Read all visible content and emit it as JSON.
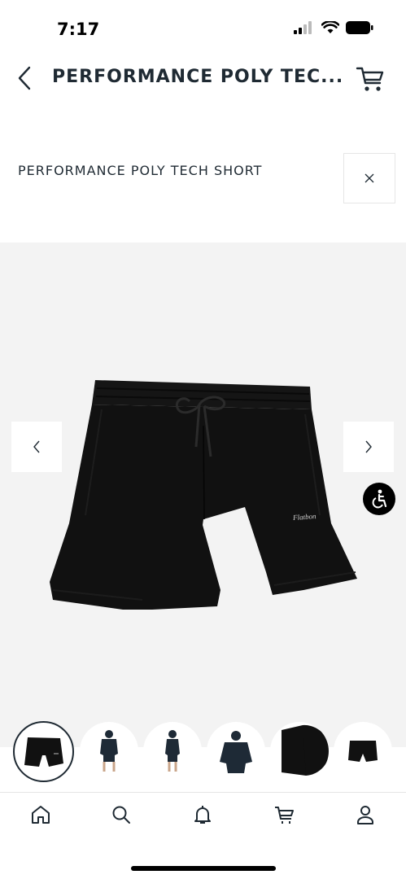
{
  "status_bar": {
    "time": "7:17",
    "icons": [
      "signal-icon",
      "wifi-icon",
      "battery-icon"
    ]
  },
  "nav": {
    "title": "PERFORMANCE POLY TEC...",
    "back_icon": "chevron-left-icon",
    "cart_icon": "cart-icon"
  },
  "product": {
    "name": "PERFORMANCE POLY TECH SHORT",
    "close_icon": "close-icon"
  },
  "gallery": {
    "prev_icon": "chevron-left-icon",
    "next_icon": "chevron-right-icon",
    "accessibility_icon": "accessibility-icon",
    "background": "#f3f3f3",
    "product_color": "#111111",
    "logo_text": "Flatbon"
  },
  "thumbnails": [
    "shorts-front",
    "model-front",
    "model-side",
    "model-back",
    "fabric-swatch",
    "shorts-flat"
  ],
  "tab_bar": {
    "items": [
      "home-icon",
      "search-icon",
      "bell-icon",
      "cart-icon",
      "profile-icon"
    ]
  },
  "colors": {
    "text": "#1f2a33",
    "accent": "#000000"
  }
}
